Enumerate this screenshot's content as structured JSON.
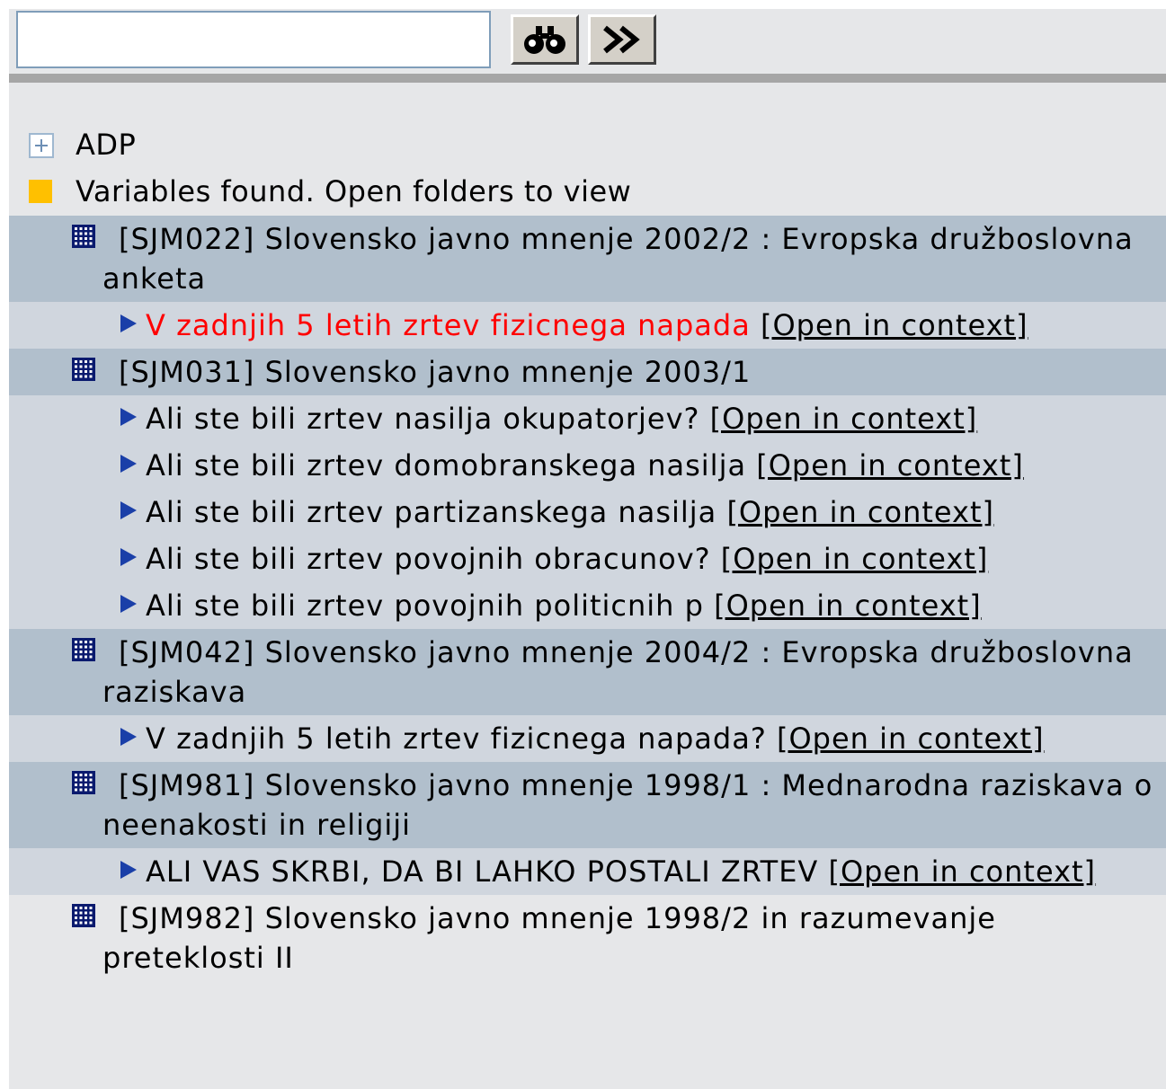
{
  "toolbar": {
    "search_value": "",
    "find_icon": "binoculars-icon",
    "next_icon": "double-chevron-right-icon"
  },
  "tree": {
    "root_label": "ADP",
    "status_label": "Variables found. Open folders to view",
    "studies": [
      {
        "title": "[SJM022] Slovensko javno mnenje 2002/2 : Evropska družboslovna anketa",
        "variables": [
          {
            "label": "V zadnjih 5 letih zrtev fizicnega napada",
            "link": "[Open in context]",
            "highlight": true
          }
        ]
      },
      {
        "title": "[SJM031] Slovensko javno mnenje 2003/1",
        "variables": [
          {
            "label": "Ali ste bili zrtev nasilja okupatorjev?",
            "link": "[Open in context]"
          },
          {
            "label": "Ali ste bili zrtev domobranskega nasilja",
            "link": "[Open in context]"
          },
          {
            "label": "Ali ste bili zrtev partizanskega nasilja",
            "link": "[Open in context]"
          },
          {
            "label": "Ali ste bili zrtev povojnih obracunov?",
            "link": "[Open in context]"
          },
          {
            "label": "Ali ste bili zrtev povojnih politicnih p",
            "link": "[Open in context]"
          }
        ]
      },
      {
        "title": "[SJM042] Slovensko javno mnenje 2004/2 : Evropska družboslovna raziskava",
        "variables": [
          {
            "label": "V zadnjih 5 letih zrtev fizicnega napada?",
            "link": "[Open in context]"
          }
        ]
      },
      {
        "title": "[SJM981] Slovensko javno mnenje 1998/1 : Mednarodna raziskava o neenakosti in religiji",
        "variables": [
          {
            "label": "ALI VAS SKRBI, DA BI LAHKO POSTALI ZRTEV",
            "link": "[Open in context]"
          }
        ]
      },
      {
        "title": "[SJM982] Slovensko javno mnenje 1998/2 in razumevanje preteklosti II",
        "variables": []
      }
    ]
  },
  "colors": {
    "highlight": "#ff0000",
    "study_band": "#b1bfcc",
    "variable_band": "#d0d6de",
    "panel": "#e6e7e9"
  }
}
